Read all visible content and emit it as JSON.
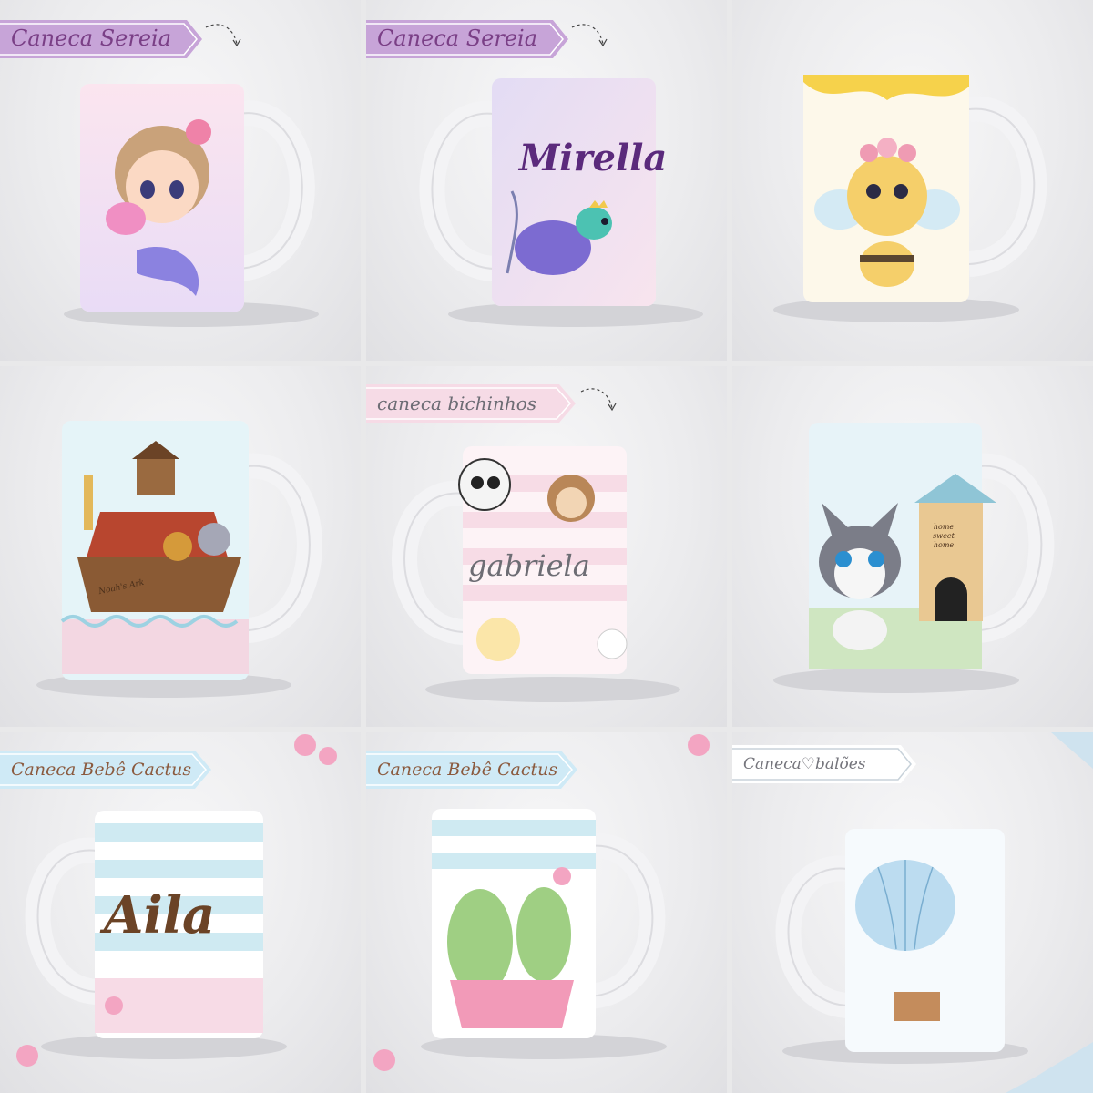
{
  "colors": {
    "sereia": "#c7a4d8",
    "bichinhos": "#f6dbe6",
    "cactus": "#cfeaf6",
    "baloes": "#ffffff",
    "name_purple": "#5b2a7c",
    "name_brown": "#6b4326",
    "name_grey": "#6d6d74"
  },
  "tiles": [
    {
      "id": "sereia-1",
      "caption": "Caneca Sereia",
      "mug_name": "",
      "theme": "mermaid girl with jellyfish"
    },
    {
      "id": "sereia-2",
      "caption": "Caneca Sereia",
      "mug_name": "Mirella",
      "theme": "sea turtle with crown"
    },
    {
      "id": "bee",
      "caption": "",
      "mug_name": "",
      "theme": "baby bee with flower crown"
    },
    {
      "id": "arca",
      "caption": "",
      "mug_name": "",
      "theme": "noah's ark animals",
      "sign_text": "Noah's Ark"
    },
    {
      "id": "bichinhos",
      "caption": "caneca bichinhos",
      "mug_name": "gabriela",
      "theme": "panda and monkey"
    },
    {
      "id": "dog",
      "caption": "",
      "mug_name": "",
      "theme": "french bulldog puppy",
      "house_sign": "home sweet home"
    },
    {
      "id": "cactus-1",
      "caption": "Caneca Bebê Cactus",
      "mug_name": "Aila",
      "theme": "stripes and flowers"
    },
    {
      "id": "cactus-2",
      "caption": "Caneca Bebê Cactus",
      "mug_name": "",
      "theme": "cactus couple in pink pot"
    },
    {
      "id": "baloes",
      "caption": "Caneca♡balões",
      "mug_name": "",
      "theme": "hot air balloon watercolor"
    }
  ]
}
